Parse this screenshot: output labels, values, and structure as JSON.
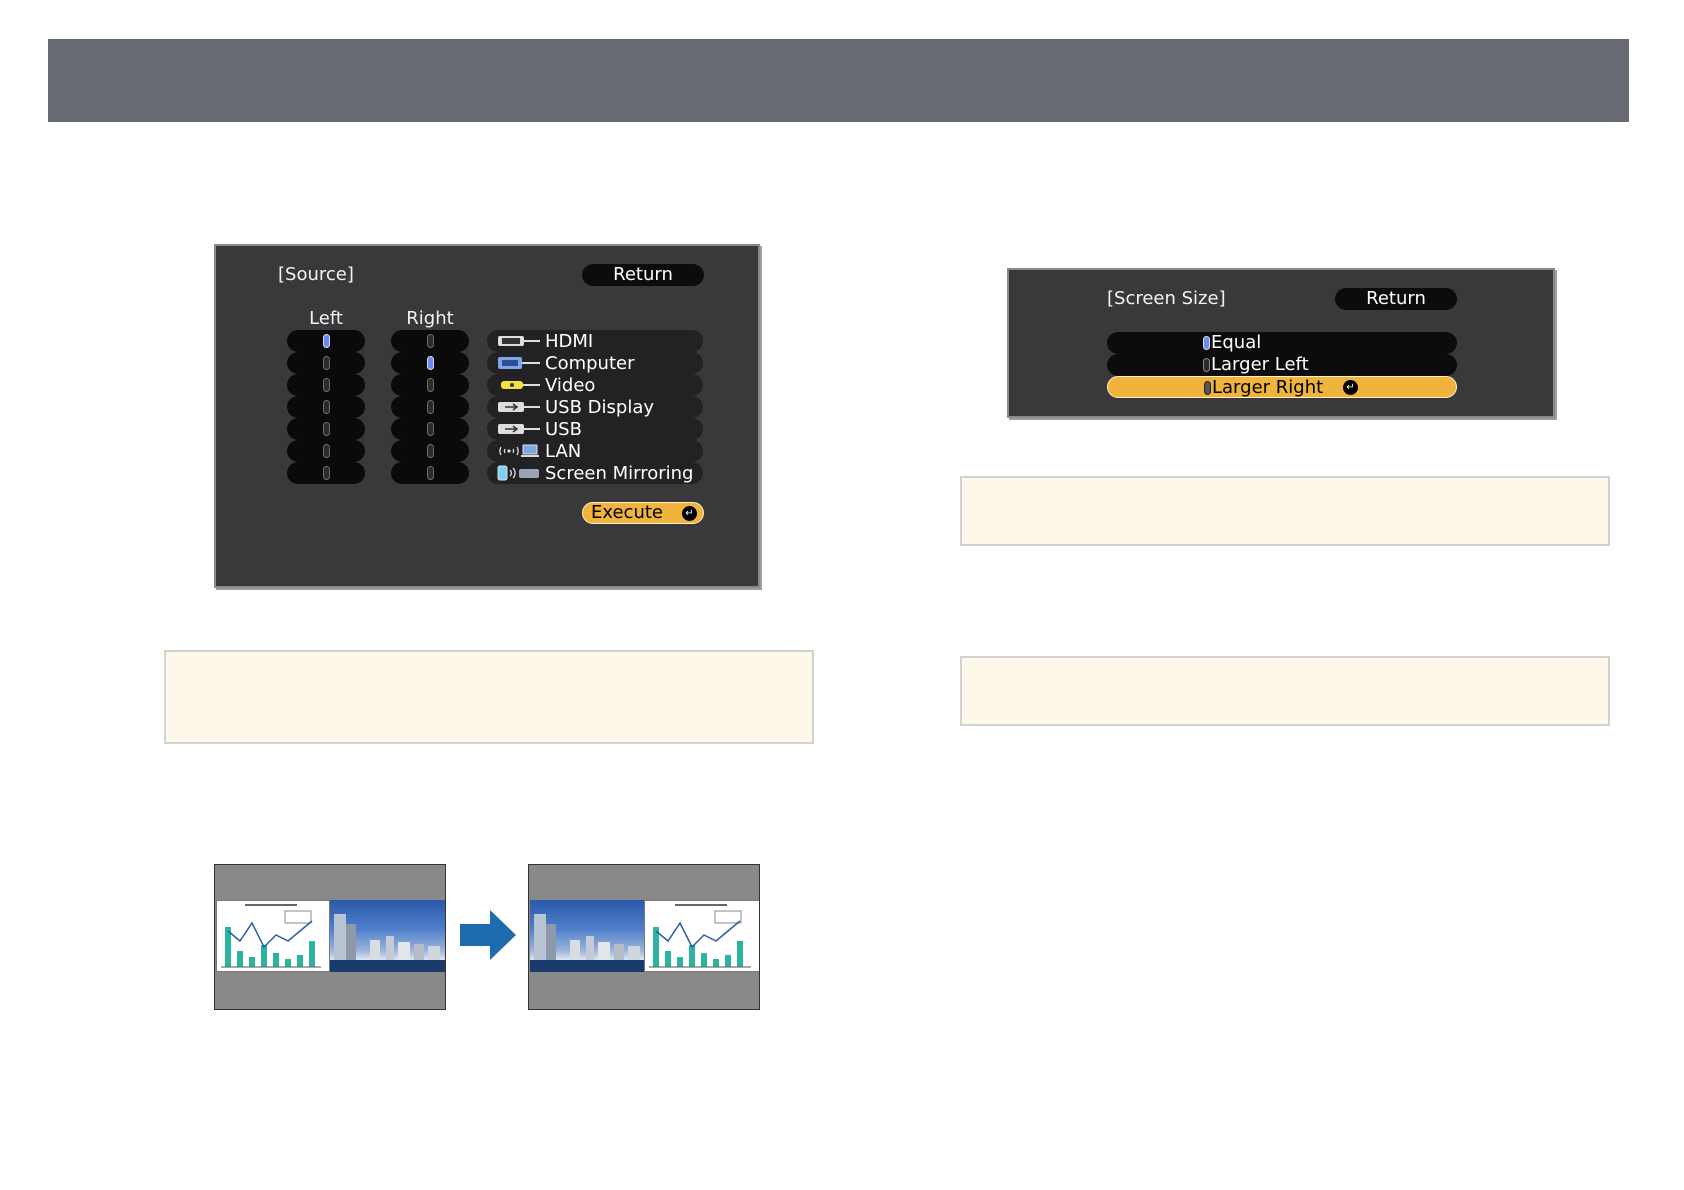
{
  "source_menu": {
    "title": "[Source]",
    "return_label": "Return",
    "left_label": "Left",
    "right_label": "Right",
    "sources": [
      {
        "label": "HDMI",
        "icon": "hdmi-icon",
        "left_selected": true,
        "right_selected": false
      },
      {
        "label": "Computer",
        "icon": "computer-port-icon",
        "left_selected": false,
        "right_selected": true
      },
      {
        "label": "Video",
        "icon": "video-rca-icon",
        "left_selected": false,
        "right_selected": false
      },
      {
        "label": "USB Display",
        "icon": "usb-display-icon",
        "left_selected": false,
        "right_selected": false
      },
      {
        "label": "USB",
        "icon": "usb-icon",
        "left_selected": false,
        "right_selected": false
      },
      {
        "label": "LAN",
        "icon": "lan-wireless-icon",
        "left_selected": false,
        "right_selected": false
      },
      {
        "label": "Screen Mirroring",
        "icon": "screen-mirroring-icon",
        "left_selected": false,
        "right_selected": false
      }
    ],
    "execute_label": "Execute"
  },
  "screen_size_menu": {
    "title": "[Screen Size]",
    "return_label": "Return",
    "options": [
      {
        "label": "Equal",
        "checked": true,
        "highlighted": false
      },
      {
        "label": "Larger Left",
        "checked": false,
        "highlighted": false
      },
      {
        "label": "Larger Right",
        "checked": false,
        "highlighted": true
      }
    ]
  },
  "colors": {
    "header_bar": "#676a72",
    "osd_background": "#39393b",
    "highlight": "#f0b43c",
    "note_background": "#fdf8ea",
    "radio_on": "#6a88ee",
    "arrow": "#1e6bb0"
  }
}
